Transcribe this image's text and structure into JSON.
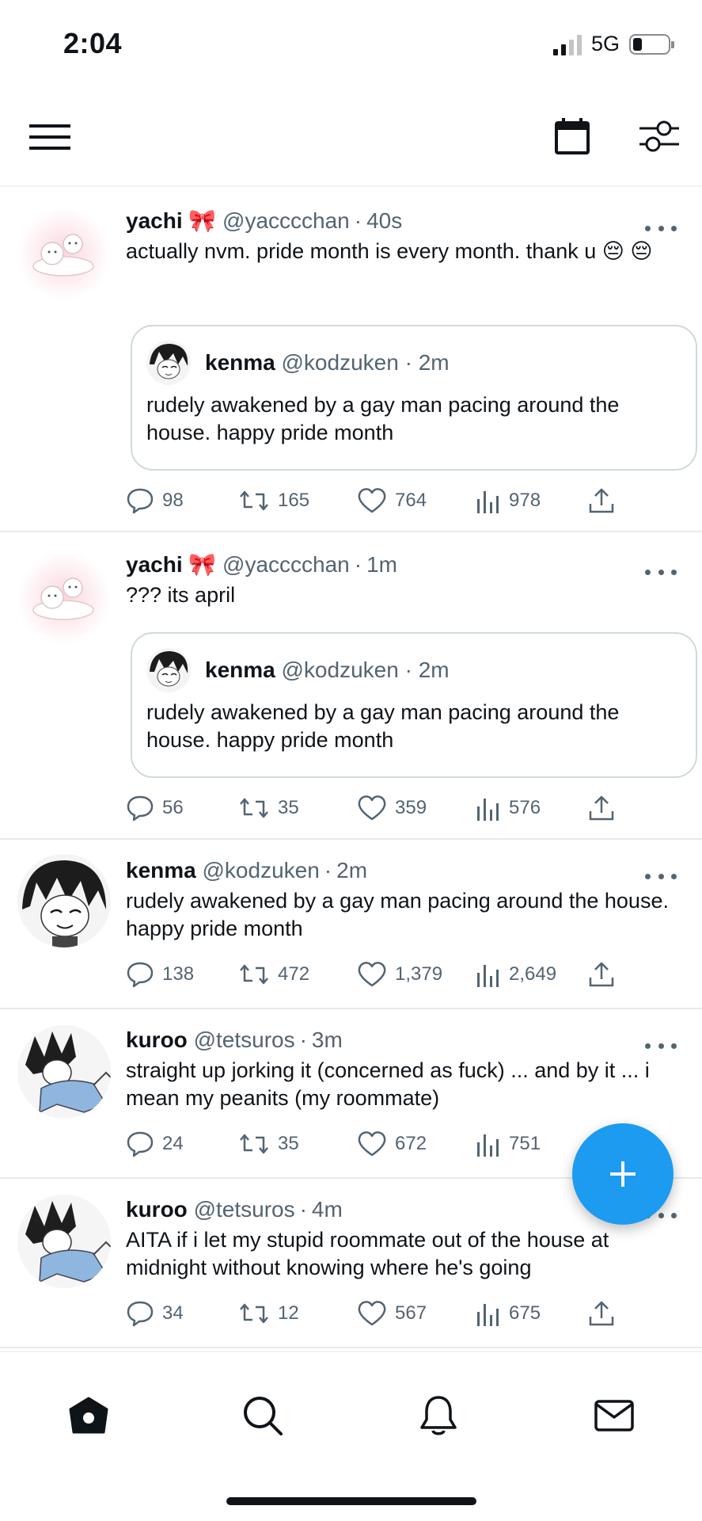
{
  "status_bar": {
    "time": "2:04",
    "network": "5G",
    "battery_level": 0.25
  },
  "colors": {
    "accent": "#1d9bf0",
    "text": "#0f1419",
    "secondary_text": "#536471"
  },
  "top_nav": {
    "menu_icon": "hamburger-icon",
    "calendar_icon": "calendar-icon",
    "filter_icon": "sliders-icon"
  },
  "tweets": [
    {
      "name": "yachi 🎀",
      "handle": "@yacccchan",
      "time": "40s",
      "text": "actually nvm. pride month is every month. thank u 😔 😔",
      "quote": {
        "name": "kenma",
        "handle": "@kodzuken",
        "time": "2m",
        "text": "rudely awakened by a gay man pacing around the house. happy pride month"
      },
      "replies": "98",
      "retweets": "165",
      "likes": "764",
      "views": "978"
    },
    {
      "name": "yachi 🎀",
      "handle": "@yacccchan",
      "time": "1m",
      "text": "??? its april",
      "quote": {
        "name": "kenma",
        "handle": "@kodzuken",
        "time": "2m",
        "text": "rudely awakened by a gay man pacing around the house. happy pride month"
      },
      "replies": "56",
      "retweets": "35",
      "likes": "359",
      "views": "576"
    },
    {
      "name": "kenma",
      "handle": "@kodzuken",
      "time": "2m",
      "text": "rudely awakened by a gay man pacing around the house. happy pride month",
      "replies": "138",
      "retweets": "472",
      "likes": "1,379",
      "views": "2,649"
    },
    {
      "name": "kuroo",
      "handle": "@tetsuros",
      "time": "3m",
      "text": "straight up jorking it (concerned as fuck) ... and by it ... i mean my peanits (my roommate)",
      "replies": "24",
      "retweets": "35",
      "likes": "672",
      "views": "751"
    },
    {
      "name": "kuroo",
      "handle": "@tetsuros",
      "time": "4m",
      "text": "AITA if i let my stupid roommate out of the house at midnight without knowing where he's going",
      "replies": "34",
      "retweets": "12",
      "likes": "567",
      "views": "675"
    }
  ],
  "fab": {
    "icon": "plus-icon"
  },
  "bottom_nav": {
    "items": [
      "home-icon",
      "search-icon",
      "bell-icon",
      "mail-icon"
    ]
  }
}
